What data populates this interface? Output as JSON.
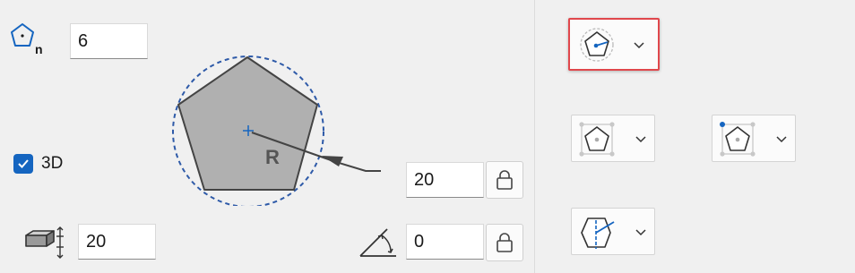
{
  "sides": {
    "icon": "polygon-sides-icon",
    "value": "6"
  },
  "diagram": {
    "radius_label": "R"
  },
  "three_d": {
    "checked": true,
    "label": "3D"
  },
  "height": {
    "icon": "extrusion-height-icon",
    "value": "20"
  },
  "radius": {
    "value": "20",
    "lock_icon": "lock-icon"
  },
  "rotation": {
    "icon": "angle-icon",
    "value": "0",
    "lock_icon": "lock-icon"
  },
  "mode_dropdowns": {
    "center_radius": {
      "icon": "polygon-center-radius-icon",
      "highlighted": true
    },
    "bounding_box": {
      "icon": "polygon-bounding-box-icon"
    },
    "corner": {
      "icon": "polygon-corner-icon"
    },
    "edge": {
      "icon": "polygon-edge-icon"
    }
  },
  "colors": {
    "accent": "#1565c0",
    "highlight": "#e0474c",
    "polygon_fill": "#b0b0b0"
  }
}
